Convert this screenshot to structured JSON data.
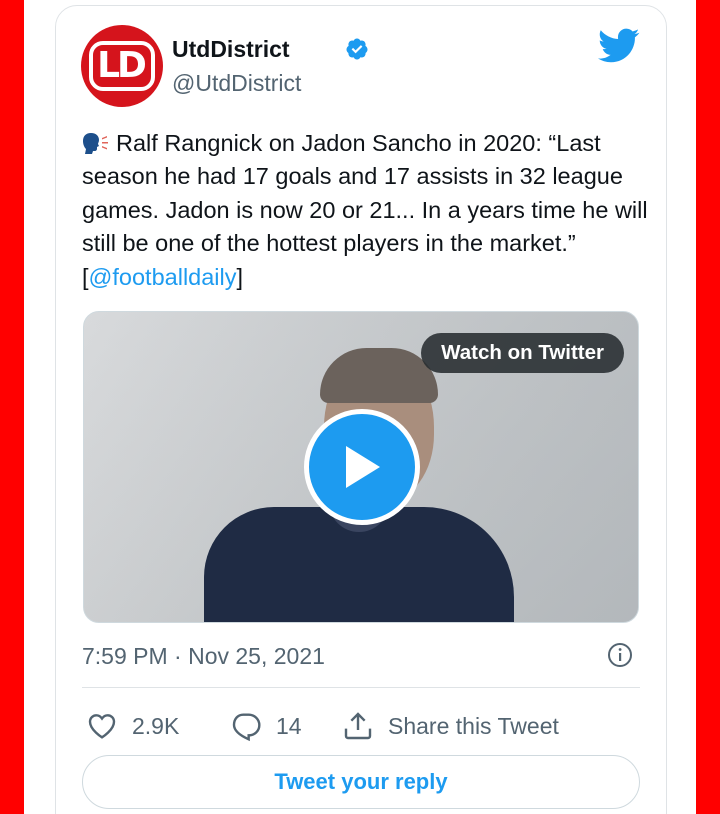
{
  "colors": {
    "border_red": "#ff0000",
    "twitter_blue": "#1d9bf0",
    "text_primary": "#0f1419",
    "text_secondary": "#536471",
    "avatar_red": "#d5141c"
  },
  "author": {
    "avatar_text": "LD",
    "avatar_icon": "utd-district-logo",
    "name": "UtdDistrict",
    "verified_icon": "verified-badge-icon",
    "handle": "@UtdDistrict"
  },
  "header": {
    "platform_icon": "twitter-bird-icon"
  },
  "tweet": {
    "leading_emoji_icon": "speaking-head-icon",
    "text_before_mention": "Ralf Rangnick on Jadon Sancho in 2020: “Last season he had 17 goals and 17 assists in 32 league games. Jadon is now 20 or 21... In a years time he will still be one of the hottest players in the market.” [",
    "mention": "@footballdaily",
    "text_after_mention": "]"
  },
  "media": {
    "watch_label": "Watch on Twitter",
    "play_icon": "play-icon"
  },
  "meta": {
    "timestamp": "7:59 PM · Nov 25, 2021",
    "info_icon": "info-icon"
  },
  "actions": {
    "likes_count": "2.9K",
    "replies_count": "14",
    "share_label": "Share this Tweet"
  },
  "reply_button_label": "Tweet your reply"
}
